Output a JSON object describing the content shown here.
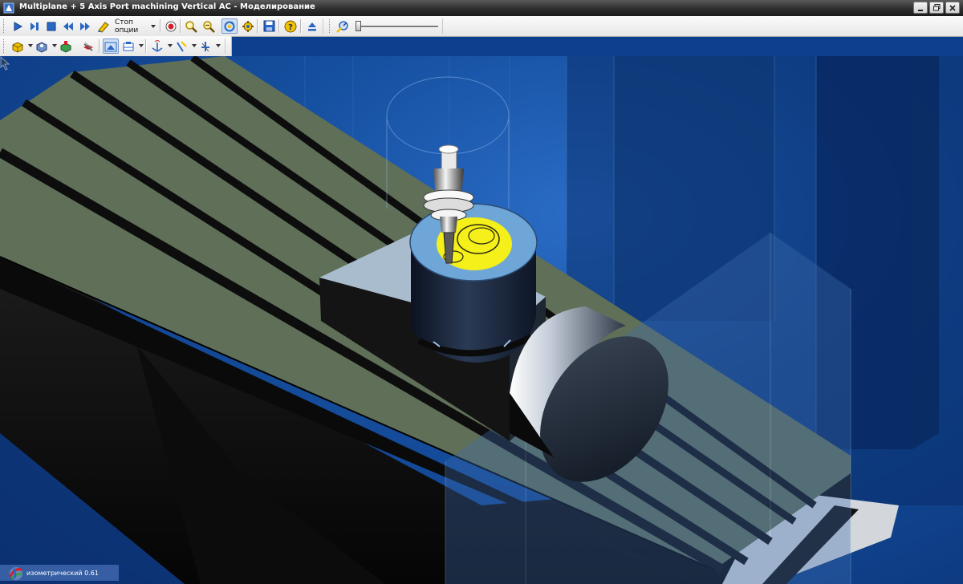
{
  "window": {
    "title": "Multiplane + 5 Axis Port machining Vertical AC - Моделирование"
  },
  "titlebar_buttons": [
    "minimize",
    "restore",
    "close"
  ],
  "toolbar1": {
    "stop_combo_label": "Стоп опции",
    "speed_slider_level": 0.0,
    "icons": [
      "play-icon",
      "step-icon",
      "stop-icon",
      "rewind-icon",
      "forward-icon",
      "verify-icon",
      "record-icon",
      "zoom-in-icon",
      "zoom-out-icon",
      "rotate-view-icon",
      "settings-icon",
      "save-icon",
      "help-icon",
      "eject-icon",
      "speed-icon"
    ]
  },
  "toolbar2": {
    "icons": [
      "stock-icon",
      "workpiece-icon",
      "fixture-icon",
      "machine-icon",
      "view-icon",
      "section-icon",
      "axis-view-icon",
      "axis-x-icon",
      "axis-y-icon"
    ]
  },
  "status": {
    "view_label": "изометрический 0.61"
  },
  "colors": {
    "background": "#154f9f",
    "table": "#5f6f58",
    "part": "#aabccb",
    "pocket": "#f5ef1a",
    "ring": "#6ea6d8"
  }
}
